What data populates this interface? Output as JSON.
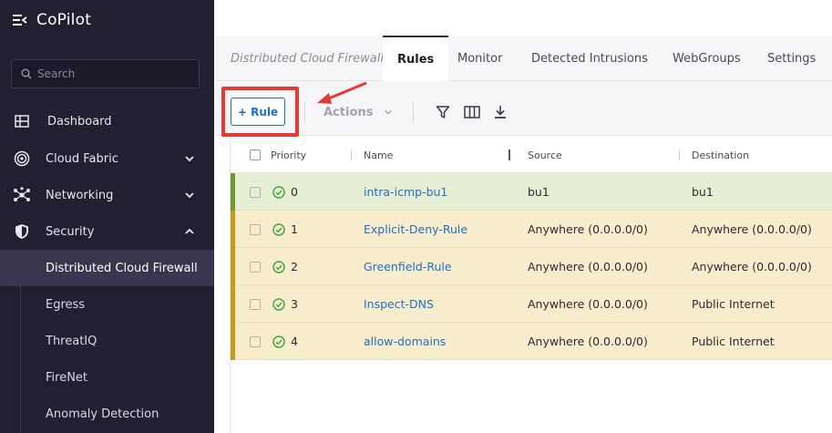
{
  "app": {
    "title": "CoPilot"
  },
  "search": {
    "placeholder": "Search"
  },
  "sidebar": {
    "items": [
      {
        "label": "Dashboard",
        "icon": "dashboard-icon"
      },
      {
        "label": "Cloud Fabric",
        "icon": "cloud-fabric-icon",
        "expanded": false
      },
      {
        "label": "Networking",
        "icon": "networking-icon",
        "expanded": false
      },
      {
        "label": "Security",
        "icon": "shield-icon",
        "expanded": true
      }
    ],
    "security_sub": [
      {
        "label": "Distributed Cloud Firewall",
        "active": true
      },
      {
        "label": "Egress"
      },
      {
        "label": "ThreatIQ"
      },
      {
        "label": "FireNet"
      },
      {
        "label": "Anomaly Detection"
      }
    ]
  },
  "tabs": {
    "breadcrumb": "Distributed Cloud Firewall",
    "items": [
      {
        "label": "Rules",
        "active": true
      },
      {
        "label": "Monitor"
      },
      {
        "label": "Detected Intrusions"
      },
      {
        "label": "WebGroups"
      },
      {
        "label": "Settings"
      }
    ]
  },
  "toolbar": {
    "add_rule_label": "+ Rule",
    "actions_label": "Actions",
    "icons": [
      "filter-icon",
      "columns-icon",
      "download-icon"
    ]
  },
  "table": {
    "headers": {
      "priority": "Priority",
      "name": "Name",
      "source": "Source",
      "destination": "Destination"
    },
    "rows": [
      {
        "priority": "0",
        "name": "intra-icmp-bu1",
        "source": "bu1",
        "destination": "bu1",
        "status": "ok",
        "row_bg": "#e6efd4",
        "bar": "#6f9a2e"
      },
      {
        "priority": "1",
        "name": "Explicit-Deny-Rule",
        "source": "Anywhere (0.0.0.0/0)",
        "destination": "Anywhere (0.0.0.0/0)",
        "status": "ok",
        "row_bg": "#f7edcc",
        "bar": "#c79a1c"
      },
      {
        "priority": "2",
        "name": "Greenfield-Rule",
        "source": "Anywhere (0.0.0.0/0)",
        "destination": "Anywhere (0.0.0.0/0)",
        "status": "ok",
        "row_bg": "#f7edcc",
        "bar": "#c79a1c"
      },
      {
        "priority": "3",
        "name": "Inspect-DNS",
        "source": "Anywhere (0.0.0.0/0)",
        "destination": "Public Internet",
        "status": "ok",
        "row_bg": "#f7edcc",
        "bar": "#c79a1c"
      },
      {
        "priority": "4",
        "name": "allow-domains",
        "source": "Anywhere (0.0.0.0/0)",
        "destination": "Public Internet",
        "status": "ok",
        "row_bg": "#f7edcc",
        "bar": "#c79a1c"
      }
    ]
  },
  "colors": {
    "accent": "#1f6fc5",
    "sidebar_bg": "#221f30",
    "highlight": "#e53935",
    "status_ok": "#3aa435"
  }
}
